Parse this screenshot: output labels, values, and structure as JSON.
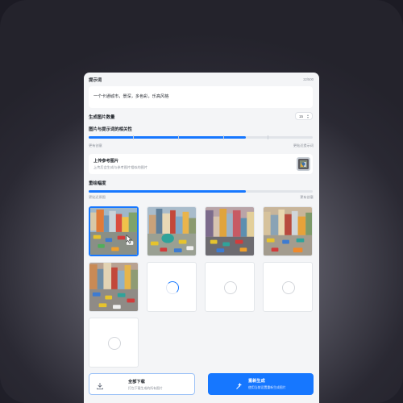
{
  "prompt": {
    "title": "提示词",
    "counter": "22/500",
    "text": "一个卡通城市，景深，多色彩，乐高风格"
  },
  "count": {
    "label": "生成图片数量",
    "value": "15",
    "stepper_icon": "chevron-updown-icon"
  },
  "relevance": {
    "label": "图片与提示词的相关性",
    "value_fraction": 0.7,
    "min_label": "更有创意",
    "max_label": "更贴近提示词"
  },
  "reference": {
    "title": "上传参考图片",
    "desc": "上传后会生成与参考图片相似的图片"
  },
  "redraw": {
    "label": "重绘幅度",
    "value_fraction": 0.7,
    "min_label": "更贴近原图",
    "max_label": "更有创意"
  },
  "gallery": {
    "selected_index": 0,
    "loading_index": 5,
    "image_count": 5,
    "placeholder_count": 4
  },
  "actions": {
    "download_title": "全部下载",
    "download_sub": "打包下载生成的所有图片",
    "regen_title": "重新生成",
    "regen_sub": "使用当前设置重新生成图片"
  },
  "colors": {
    "accent": "#1677ff",
    "panel_bg": "#f4f5f7"
  }
}
